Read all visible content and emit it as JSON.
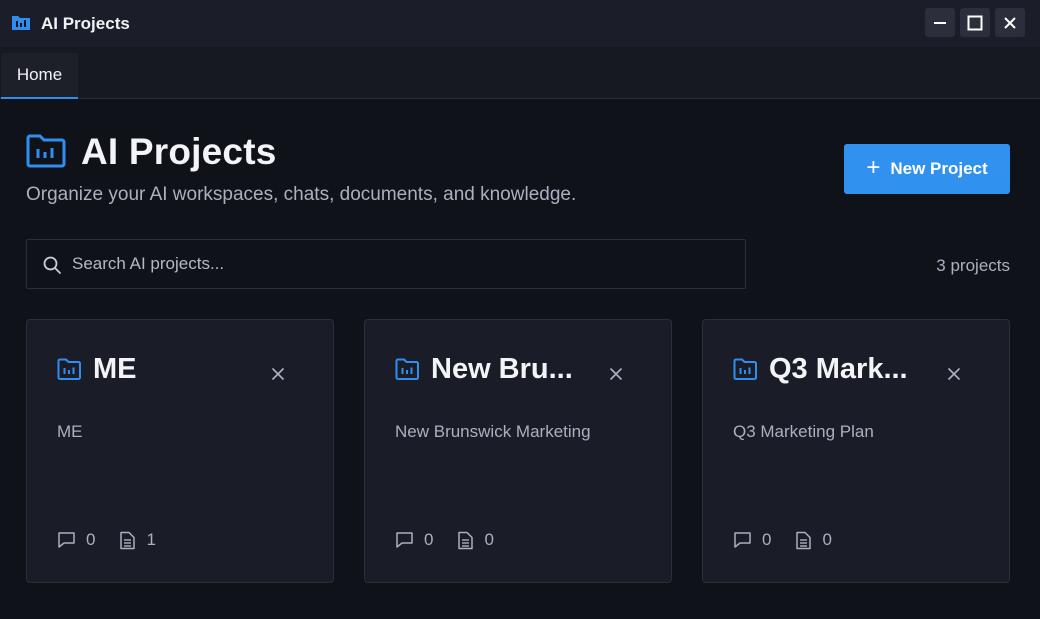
{
  "window": {
    "title": "AI Projects",
    "controls": [
      "minimize",
      "maximize",
      "close"
    ]
  },
  "tabs": [
    {
      "label": "Home",
      "active": true
    }
  ],
  "header": {
    "title": "AI Projects",
    "subtitle": "Organize your AI workspaces, chats, documents, and knowledge.",
    "new_button_label": "New Project"
  },
  "search": {
    "placeholder": "Search AI projects...",
    "value": ""
  },
  "project_count": "3 projects",
  "projects": [
    {
      "title": "ME",
      "description": "ME",
      "chats": "0",
      "documents": "1"
    },
    {
      "title": "New Bru...",
      "description": "New Brunswick Marketing",
      "chats": "0",
      "documents": "0"
    },
    {
      "title": "Q3 Mark...",
      "description": "Q3 Marketing Plan",
      "chats": "0",
      "documents": "0"
    }
  ],
  "colors": {
    "accent": "#3191ee",
    "background": "#10121a",
    "card": "#1a1d27",
    "titlebar": "#1b1e28"
  },
  "icons": {
    "app": "folder-chart-icon",
    "project": "folder-chart-icon",
    "search": "search-icon",
    "close": "close-icon",
    "chats": "chat-bubble-icon",
    "documents": "document-icon"
  }
}
